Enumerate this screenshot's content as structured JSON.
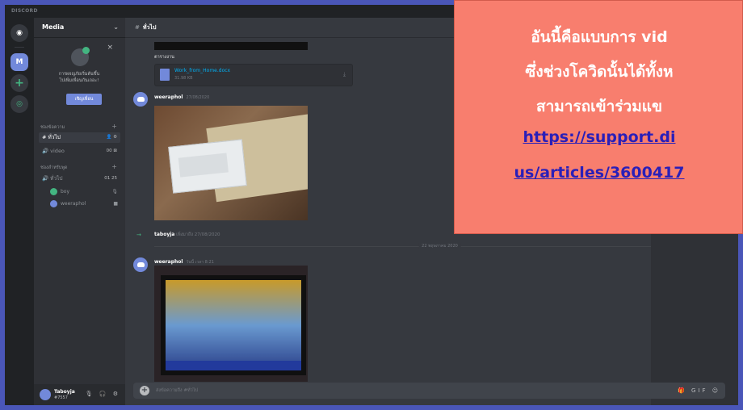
{
  "window": {
    "app_label": "DISCORD"
  },
  "rail": {
    "server_initial": "M",
    "add_symbol": "+"
  },
  "sidebar": {
    "server_name": "Media",
    "invite": {
      "text_line1": "การผจญภัยเริ่มต้นขึ้น",
      "text_line2": "ไปเพิ่มเพื่อนกันเถอะ!",
      "button": "เชิญเพื่อน"
    },
    "category_text": "ช่องข้อความ",
    "category_voice": "ช่องสำหรับพูด",
    "channels": [
      {
        "label": "# ทั่วไป",
        "meta": "👤 ⚙"
      },
      {
        "label": "🔊 video",
        "meta": "00 ⊠"
      },
      {
        "label": "🔊 ทั่วไป",
        "meta": "01 25"
      }
    ],
    "voice_users": [
      {
        "name": "boy"
      },
      {
        "name": "weeraphol"
      }
    ],
    "user": {
      "name": "Taboyja",
      "tag": "#7557",
      "icons": "🎙 🎧 ⚙"
    }
  },
  "chat": {
    "channel_name": "ทั่วไป",
    "attachment_label": "ตารางงาน",
    "file": {
      "name": "Work_from_Home.docx",
      "size": "31.98 KB"
    },
    "messages": [
      {
        "author": "weeraphol",
        "timestamp": "27/08/2020"
      },
      {
        "author": "weeraphol",
        "timestamp": "วันนี้ เวลา 8:21"
      }
    ],
    "join": {
      "user": "taboyja",
      "action": "เพิ่งมาถึง",
      "timestamp": "27/08/2020"
    },
    "date_divider": "22 พฤษภาคม 2020",
    "composer_placeholder": "ส่งข้อความถึง #ทั่วไป",
    "composer_icons": "🎁 GIF ☺"
  },
  "note": {
    "line1": "อันนี้คือแบบการ vid",
    "line2": "ซึ่งช่วงโควิดนั้นได้ทั้งห",
    "line3": "สามารถเข้าร่วมแข",
    "link1": "https://support.di",
    "link2": "us/articles/3600417"
  },
  "colors": {
    "background": "#4a56b8",
    "note": "#f87e6e",
    "accent": "#7289da",
    "online": "#43b581"
  }
}
